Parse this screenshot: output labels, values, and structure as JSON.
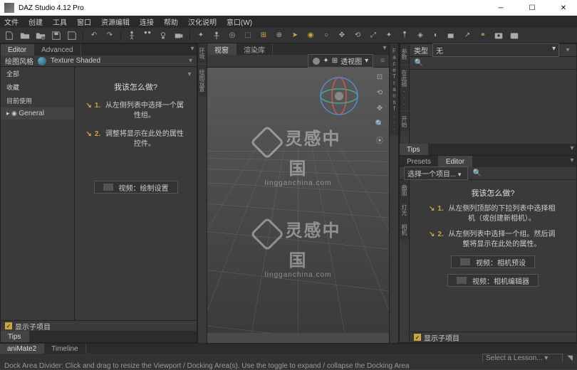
{
  "titlebar": {
    "title": "DAZ Studio 4.12 Pro"
  },
  "menubar": [
    "文件",
    "创建",
    "工具",
    "窗口",
    "资源编辑",
    "连接",
    "帮助",
    "汉化说明",
    "意口(W)"
  ],
  "left": {
    "tabs": {
      "editor": "Editor",
      "advanced": "Advanced"
    },
    "shading_label": "绘图风格",
    "shading_mode": "Texture Shaded",
    "nav": {
      "all": "全部",
      "fav": "收藏",
      "recent": "目前使用",
      "general": "General"
    },
    "help": {
      "title": "我该怎么做?",
      "step1_num": "1.",
      "step1": "从左侧列表中选择一个属性组。",
      "step2_num": "2.",
      "step2": "调整将显示在此处的属性控件。",
      "video": "视频：绘制设置"
    },
    "show_children": "显示子项目",
    "tips_tab": "Tips"
  },
  "viewport": {
    "tabs": {
      "view": "视窗",
      "render": "渲染库"
    },
    "camera": "透视图",
    "wm_big": "灵感中国",
    "wm_sub": "lingganchina.com"
  },
  "rails_left": [
    "环境",
    "绘图设置"
  ],
  "rails_mid_right": [
    "FaceTransf..."
  ],
  "right": {
    "rail_top": [
      "参数",
      "在此插...",
      "开始"
    ],
    "type_label": "类型",
    "type_value": "无",
    "tips_tab": "Tips",
    "sub_tabs": {
      "presets": "Presets",
      "editor": "Editor"
    },
    "select_prompt": "选择一个项目...",
    "help": {
      "title": "我该怎么做?",
      "step1_num": "1.",
      "step1": "从左侧列顶部的下拉列表中选择相机（或创建新相机）。",
      "step2_num": "2.",
      "step2": "从左侧列表中选择一个组。然后调整将显示在此处的属性。",
      "video1": "视频：相机预设",
      "video2": "视频：相机编辑器"
    },
    "show_children": "显示子项目",
    "rail_bottom": [
      "曲面",
      "灯光",
      "相机"
    ]
  },
  "bottom": {
    "tabs": {
      "animate": "aniMate2",
      "timeline": "Timeline"
    },
    "lesson_label": "Select a Lesson...",
    "status": "Dock Area Divider: Click and drag to resize the Viewport / Docking Area(s). Use the toggle to expand / collapse the Docking Area"
  }
}
